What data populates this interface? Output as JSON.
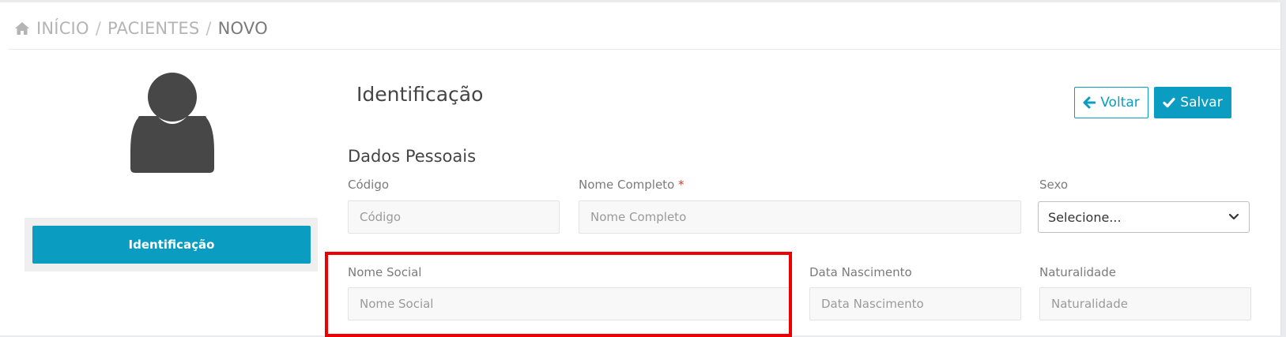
{
  "breadcrumb": {
    "home": "INÍCIO",
    "patients": "PACIENTES",
    "current": "NOVO",
    "separator": "/"
  },
  "sidebar": {
    "active_tab": "Identificação"
  },
  "header": {
    "title": "Identificação",
    "back_label": "Voltar",
    "save_label": "Salvar"
  },
  "form": {
    "section_title": "Dados Pessoais",
    "codigo": {
      "label": "Código",
      "placeholder": "Código"
    },
    "nome_completo": {
      "label": "Nome Completo",
      "required_mark": "*",
      "placeholder": "Nome Completo"
    },
    "sexo": {
      "label": "Sexo",
      "selected": "Selecione..."
    },
    "nome_social": {
      "label": "Nome Social",
      "placeholder": "Nome Social"
    },
    "data_nascimento": {
      "label": "Data Nascimento",
      "placeholder": "Data Nascimento"
    },
    "naturalidade": {
      "label": "Naturalidade",
      "placeholder": "Naturalidade"
    }
  },
  "colors": {
    "accent": "#0b9cc2",
    "highlight": "#ee0000",
    "required": "#d9372b"
  },
  "icons": {
    "home": "home-icon",
    "avatar": "user-avatar-icon",
    "back": "arrow-left-icon",
    "save": "check-icon",
    "dropdown": "chevron-down-icon"
  }
}
